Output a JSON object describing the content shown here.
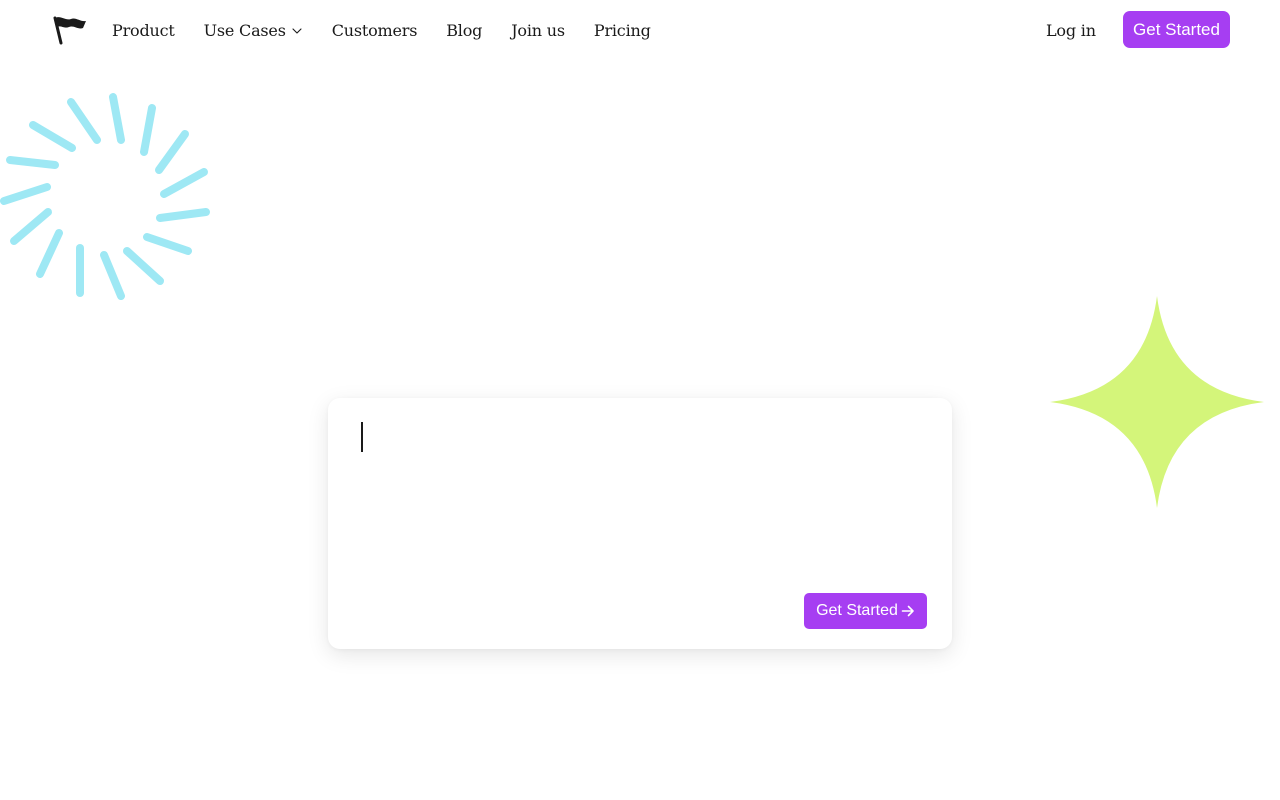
{
  "header": {
    "logo_icon": "flag-icon",
    "nav": [
      {
        "label": "Product"
      },
      {
        "label": "Use Cases",
        "icon": "chevron-down-icon"
      },
      {
        "label": "Customers"
      },
      {
        "label": "Blog"
      },
      {
        "label": "Join us"
      },
      {
        "label": "Pricing"
      }
    ],
    "login_label": "Log in",
    "cta_label": "Get Started"
  },
  "prompt_card": {
    "input_value": "",
    "cta_label": "Get Started",
    "cta_icon": "arrow-right-icon"
  },
  "decorations": {
    "left": "sunburst-icon",
    "right": "sparkle-icon"
  },
  "colors": {
    "accent": "#a63ef2",
    "burst": "#9ee8f4",
    "sparkle": "#d4f57a",
    "text": "#1a1a1a",
    "background": "#ffffff"
  }
}
